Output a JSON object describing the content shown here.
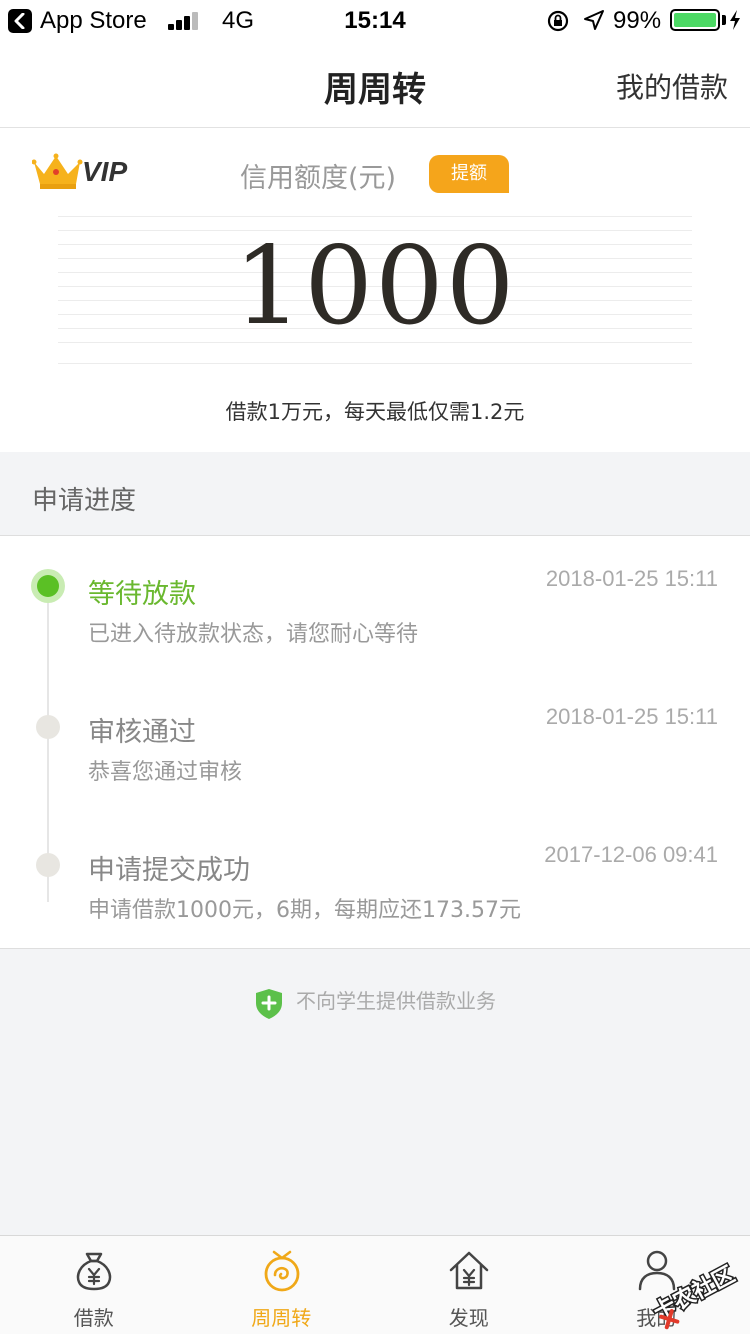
{
  "status_bar": {
    "back_app": "App Store",
    "network": "4G",
    "time": "15:14",
    "battery": "99%",
    "battery_level": 0.99,
    "battery_color": "#4cd964"
  },
  "nav": {
    "title": "周周转",
    "right_action": "我的借款"
  },
  "credit": {
    "vip_label": "VIP",
    "label": "信用额度(元)",
    "raise_button": "提额",
    "amount": "1000",
    "note": "借款1万元，每天最低仅需1.2元",
    "accent_color": "#f5a51b"
  },
  "progress": {
    "title": "申请进度",
    "items": [
      {
        "title": "等待放款",
        "time": "2018-01-25 15:11",
        "desc": "已进入待放款状态，请您耐心等待",
        "active": true
      },
      {
        "title": "审核通过",
        "time": "2018-01-25 15:11",
        "desc": "恭喜您通过审核",
        "active": false
      },
      {
        "title": "申请提交成功",
        "time": "2017-12-06 09:41",
        "desc": "申请借款1000元，6期，每期应还173.57元",
        "active": false
      }
    ],
    "active_color": "#5bc025"
  },
  "notice": {
    "icon": "shield-plus-icon",
    "text": "不向学生提供借款业务"
  },
  "tabbar": {
    "tabs": [
      {
        "label": "借款",
        "icon": "money-bag-icon",
        "active": false
      },
      {
        "label": "周周转",
        "icon": "coin-swirl-icon",
        "active": true
      },
      {
        "label": "发现",
        "icon": "house-yen-icon",
        "active": false
      },
      {
        "label": "我的",
        "icon": "person-icon",
        "active": false
      }
    ],
    "active_color": "#f0a818"
  },
  "watermark": {
    "text": "卡农社区"
  }
}
